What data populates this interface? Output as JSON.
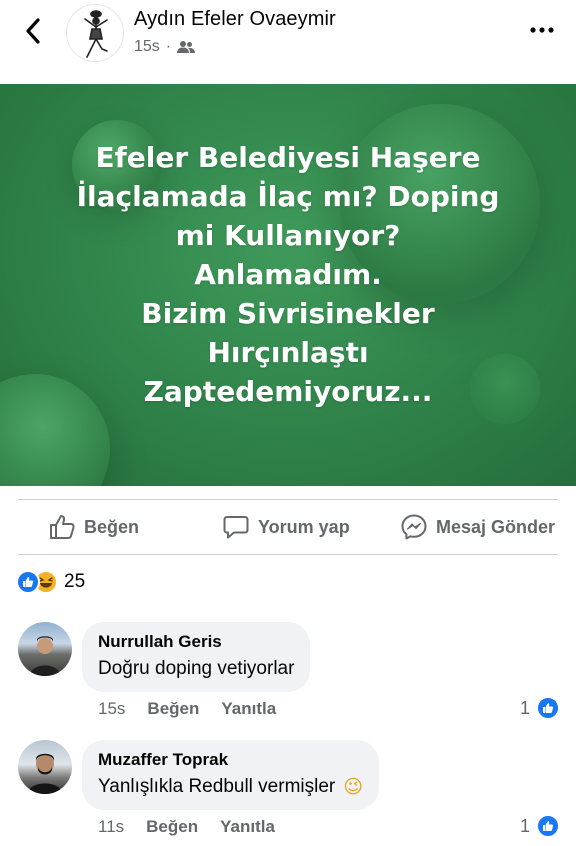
{
  "header": {
    "page_name": "Aydın Efeler Ovaeymir",
    "time": "15s",
    "audience_icon": "friends-icon",
    "back_icon": "chevron-left-icon",
    "more_icon": "more-dots-icon"
  },
  "post": {
    "lines": [
      "Efeler Belediyesi Haşere",
      "İlaçlamada İlaç mı? Doping",
      "mi Kullanıyor?",
      "Anlamadım.",
      "Bizim Sivrisinekler",
      "Hırçınlaştı",
      "Zaptedemiyoruz..."
    ],
    "background_color": "#2f8249"
  },
  "actions": {
    "like_label": "Beğen",
    "comment_label": "Yorum yap",
    "message_label": "Mesaj Gönder"
  },
  "reactions": {
    "count": "25",
    "types": [
      "like",
      "haha"
    ]
  },
  "comments": [
    {
      "name": "Nurrullah Geris",
      "text": "Doğru doping vetiyorlar",
      "time": "15s",
      "like_label": "Beğen",
      "reply_label": "Yanıtla",
      "like_count": "1"
    },
    {
      "name": "Muzaffer Toprak",
      "text": "Yanlışlıkla Redbull vermişler",
      "emoji": "😉",
      "time": "11s",
      "like_label": "Beğen",
      "reply_label": "Yanıtla",
      "like_count": "1"
    }
  ],
  "colors": {
    "facebook_blue": "#1877f2",
    "secondary_text": "#65676b",
    "bubble_bg": "#f0f2f5"
  }
}
